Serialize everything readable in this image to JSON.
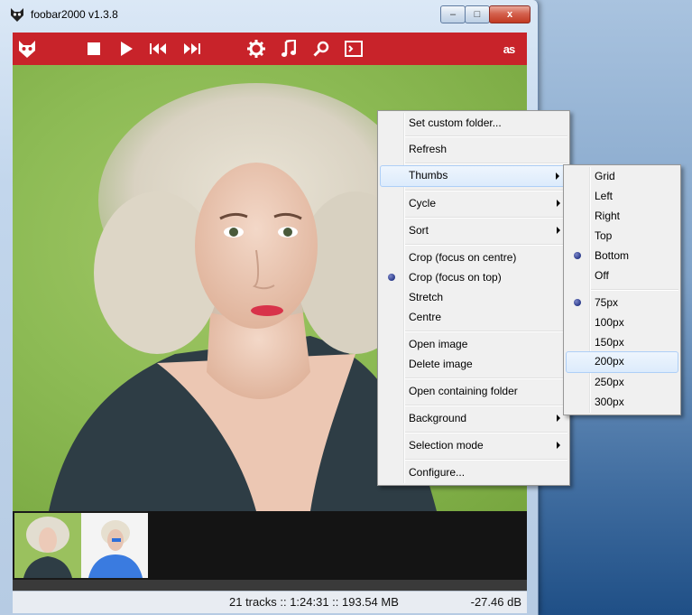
{
  "window": {
    "title": "foobar2000 v1.3.8",
    "controls": {
      "minimize": "–",
      "maximize": "□",
      "close": "x"
    }
  },
  "toolbar": {
    "buttons": [
      "stop-icon",
      "play-icon",
      "previous-icon",
      "next-icon",
      "settings-icon",
      "music-note-icon",
      "search-icon",
      "console-icon",
      "lastfm-icon"
    ],
    "lastfm_label": "as",
    "color": "#c8232a"
  },
  "status": {
    "summary": "21 tracks :: 1:24:31 :: 193.54 MB",
    "gain": "-27.46 dB"
  },
  "context_menu": {
    "items": [
      {
        "label": "Set custom folder..."
      },
      {
        "label": "Refresh"
      },
      {
        "label": "Thumbs"
      },
      {
        "label": "Cycle"
      },
      {
        "label": "Sort"
      },
      {
        "label": "Crop (focus on centre)"
      },
      {
        "label": "Crop (focus on top)"
      },
      {
        "label": "Stretch"
      },
      {
        "label": "Centre"
      },
      {
        "label": "Open image"
      },
      {
        "label": "Delete image"
      },
      {
        "label": "Open containing folder"
      },
      {
        "label": "Background"
      },
      {
        "label": "Selection mode"
      },
      {
        "label": "Configure..."
      }
    ],
    "checked": "Crop (focus on top)",
    "highlighted": "Thumbs"
  },
  "thumbs_submenu": {
    "positions": [
      "Grid",
      "Left",
      "Right",
      "Top",
      "Bottom",
      "Off"
    ],
    "sizes": [
      "75px",
      "100px",
      "150px",
      "200px",
      "250px",
      "300px"
    ],
    "selected_position": "Bottom",
    "selected_size": "75px",
    "highlighted": "200px"
  }
}
